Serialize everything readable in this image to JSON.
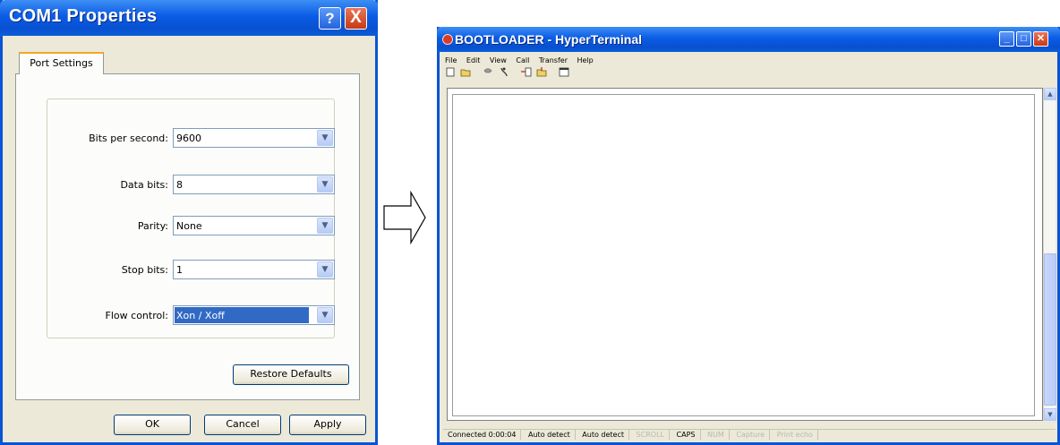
{
  "com1_dialog": {
    "title": "COM1 Properties",
    "help_button": "?",
    "close_button": "X",
    "tab_label": "Port Settings",
    "fields": [
      {
        "label": "Bits per second:",
        "value": "9600"
      },
      {
        "label": "Data bits:",
        "value": "8"
      },
      {
        "label": "Parity:",
        "value": "None"
      },
      {
        "label": "Stop bits:",
        "value": "1"
      },
      {
        "label": "Flow control:",
        "value": "Xon / Xoff"
      }
    ],
    "restore_defaults": "Restore Defaults",
    "ok": "OK",
    "cancel": "Cancel",
    "apply": "Apply"
  },
  "hyperterminal": {
    "title": "BOOTLOADER - HyperTerminal",
    "menu": [
      "File",
      "Edit",
      "View",
      "Call",
      "Transfer",
      "Help"
    ],
    "toolbar_icons": [
      "new-icon",
      "open-icon",
      "call-icon",
      "disconnect-icon",
      "send-icon",
      "receive-icon",
      "properties-icon"
    ],
    "status": {
      "connected": "Connected 0:00:04",
      "detect1": "Auto detect",
      "detect2": "Auto detect",
      "scroll": "SCROLL",
      "caps": "CAPS",
      "num": "NUM",
      "capture": "Capture",
      "print_echo": "Print echo"
    }
  }
}
